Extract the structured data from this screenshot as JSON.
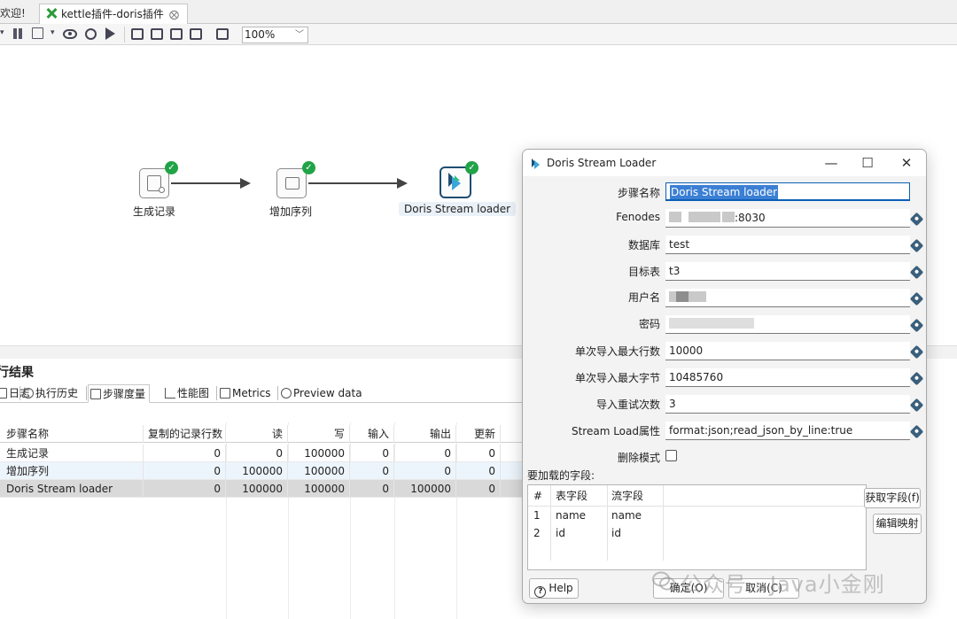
{
  "tabs": {
    "welcome_label": "欢迎!",
    "active_label": "kettle插件-doris插件",
    "close_glyph": "⨂"
  },
  "toolbar": {
    "zoom_value": "100%"
  },
  "canvas": {
    "steps": [
      {
        "name": "生成记录",
        "status": "ok"
      },
      {
        "name": "增加序列",
        "status": "ok"
      },
      {
        "name": "Doris Stream loader",
        "status": "ok"
      }
    ]
  },
  "results": {
    "title": "行结果",
    "tabs": [
      "日志",
      "执行历史",
      "步骤度量",
      "性能图",
      "Metrics",
      "Preview data"
    ],
    "active_tab": "步骤度量",
    "columns": [
      "步骤名称",
      "复制的记录行数",
      "读",
      "写",
      "输入",
      "输出",
      "更新"
    ],
    "rows": [
      [
        "生成记录",
        "0",
        "0",
        "100000",
        "0",
        "0",
        "0"
      ],
      [
        "增加序列",
        "0",
        "100000",
        "100000",
        "0",
        "0",
        "0"
      ],
      [
        "Doris Stream loader",
        "0",
        "100000",
        "100000",
        "0",
        "100000",
        "0"
      ]
    ]
  },
  "dialog": {
    "title": "Doris Stream Loader",
    "window_buttons": {
      "minimize": "—",
      "maximize": "☐",
      "close": "✕"
    },
    "fields": {
      "step_name": {
        "label": "步骤名称",
        "value": "Doris Stream loader"
      },
      "fenodes": {
        "label": "Fenodes",
        "value": ":8030"
      },
      "database": {
        "label": "数据库",
        "value": "test"
      },
      "table": {
        "label": "目标表",
        "value": "t3"
      },
      "username": {
        "label": "用户名",
        "value": ""
      },
      "password": {
        "label": "密码",
        "value": ""
      },
      "max_rows": {
        "label": "单次导入最大行数",
        "value": "10000"
      },
      "max_bytes": {
        "label": "单次导入最大字节",
        "value": "10485760"
      },
      "retries": {
        "label": "导入重试次数",
        "value": "3"
      },
      "stream_load_props": {
        "label": "Stream Load属性",
        "value": "format:json;read_json_by_line:true"
      },
      "delete_mode": {
        "label": "删除模式",
        "checked": false
      }
    },
    "fields_section": {
      "title": "要加载的字段:",
      "columns": [
        "#",
        "表字段",
        "流字段"
      ],
      "rows": [
        [
          "1",
          "name",
          "name"
        ],
        [
          "2",
          "id",
          "id"
        ]
      ]
    },
    "buttons": {
      "get_fields": "获取字段(f)",
      "edit_mapping": "编辑映射",
      "help": "Help",
      "ok": "确定(O)",
      "cancel": "取消(C)"
    }
  },
  "watermark": "公众号 · Java小金刚",
  "colors": {
    "status_ok": "#21a347",
    "doris_brand": "#1e4d72",
    "selection": "#3b7fd4",
    "row_alt": "#edf5fc",
    "row_selected": "#d9d9d9"
  }
}
